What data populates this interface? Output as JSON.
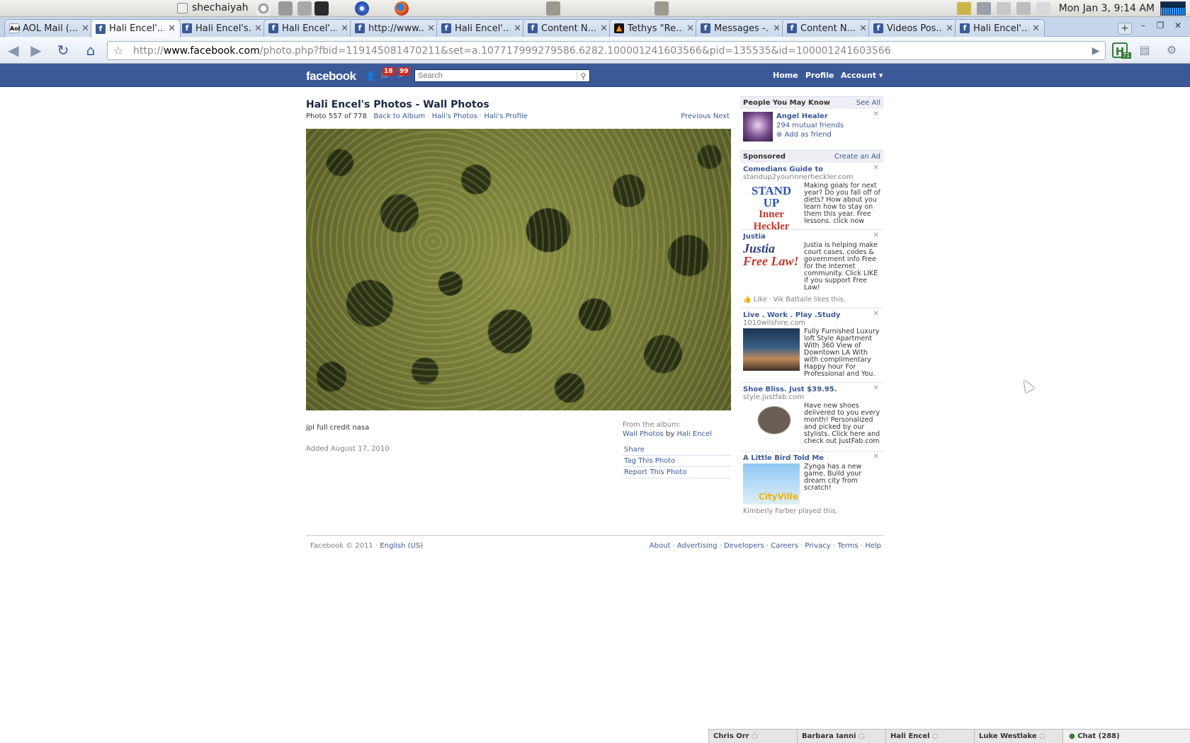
{
  "panel": {
    "username": "shechaiyah",
    "clock": "Mon Jan  3,  9:14 AM"
  },
  "tabs": [
    {
      "title": "AOL Mail (...",
      "favicon": "aol-icon"
    },
    {
      "title": "Hali Encel'...",
      "favicon": "facebook-icon",
      "active": true
    },
    {
      "title": "Hali Encel's...",
      "favicon": "facebook-icon"
    },
    {
      "title": "Hali Encel'...",
      "favicon": "facebook-icon"
    },
    {
      "title": "http://www...",
      "favicon": "facebook-icon"
    },
    {
      "title": "Hali Encel'...",
      "favicon": "facebook-icon"
    },
    {
      "title": "Content N...",
      "favicon": "facebook-icon"
    },
    {
      "title": "Tethys \"Re...",
      "favicon": "tethys-icon"
    },
    {
      "title": "Messages -...",
      "favicon": "facebook-icon"
    },
    {
      "title": "Content N...",
      "favicon": "facebook-icon"
    },
    {
      "title": "Videos Pos...",
      "favicon": "facebook-icon"
    },
    {
      "title": "Hali Encel'...",
      "favicon": "facebook-icon"
    }
  ],
  "omnibox": {
    "scheme": "http://",
    "host": "www.facebook.com",
    "path": "/photo.php?fbid=119145081470211&set=a.107717999279586.6282.100001241603566&pid=135535&id=100001241603566"
  },
  "extension_badge": "71",
  "fb": {
    "logo": "facebook",
    "messages_count": "18",
    "notifications_count": "99",
    "search_placeholder": "Search",
    "nav": {
      "home": "Home",
      "profile": "Profile",
      "account": "Account"
    }
  },
  "photo": {
    "title": "Hali Encel's Photos - Wall Photos",
    "counter": "Photo 557 of 778",
    "back_to_album": "Back to Album",
    "sep": "·",
    "halis_photos": "Hali's Photos",
    "halis_profile": "Hali's Profile",
    "previous": "Previous",
    "next": "Next",
    "caption": "jpl full credit nasa",
    "added": "Added August 17, 2010",
    "from_album": "From the album:",
    "album_name": "Wall Photos",
    "by": "by",
    "owner": "Hali Encel",
    "actions": [
      "Share",
      "Tag This Photo",
      "Report This Photo"
    ]
  },
  "pymk": {
    "header": "People You May Know",
    "see_all": "See All",
    "name": "Angel Healer",
    "mutual": "294 mutual friends",
    "add": "Add as friend"
  },
  "sponsored": {
    "header": "Sponsored",
    "create_ad": "Create an Ad",
    "ads": [
      {
        "title": "Comedians Guide to",
        "url": "standup2yourinnerheckler.com",
        "img_line1": "STAND UP",
        "img_line2": "Inner Heckler",
        "text": "Making goals for next year? Do you fall off of diets? How about you learn how to stay on them this year. Free lessons. click now",
        "social": ""
      },
      {
        "title": "Justia",
        "url": "",
        "img_line1": "Justia",
        "img_line2": "Free Law!",
        "text": "Justia is helping make court cases, codes & government info Free for the Internet community. Click LIKE if you support Free Law!",
        "social": "Like · Vik Battaile likes this."
      },
      {
        "title": "Live . Work . Play .Study",
        "url": "1010wilshire.com",
        "img_line1": "",
        "img_line2": "",
        "text": "Fully Furnished Luxury loft Style Apartment With 360 View of Downtown LA With with complimentary Happy hour For Professional and You.",
        "social": ""
      },
      {
        "title": "Shoe Bliss. Just $39.95.",
        "url": "style.justfab.com",
        "img_line1": "",
        "img_line2": "",
        "text": "Have new shoes delivered to you every month! Personalized and picked by our stylists. Click here and check out JustFab.com",
        "social": ""
      },
      {
        "title": "A Little Bird Told Me",
        "url": "",
        "img_line1": "",
        "img_line2": "",
        "text": "Zynga has a new game. Build your dream city from scratch!",
        "social": "Kimberly Farber played this."
      }
    ]
  },
  "footer": {
    "copyright": "Facebook © 2011",
    "language": "English (US)",
    "links": [
      "About",
      "Advertising",
      "Developers",
      "Careers",
      "Privacy",
      "Terms",
      "Help"
    ]
  },
  "chat": {
    "friends": [
      "Chris Orr",
      "Barbara Ianni",
      "Hali Encel",
      "Luke Westlake"
    ],
    "chat_label": "Chat (288)"
  },
  "colors": {
    "fb_blue": "#3b5998",
    "badge_red": "#d02a1e"
  }
}
